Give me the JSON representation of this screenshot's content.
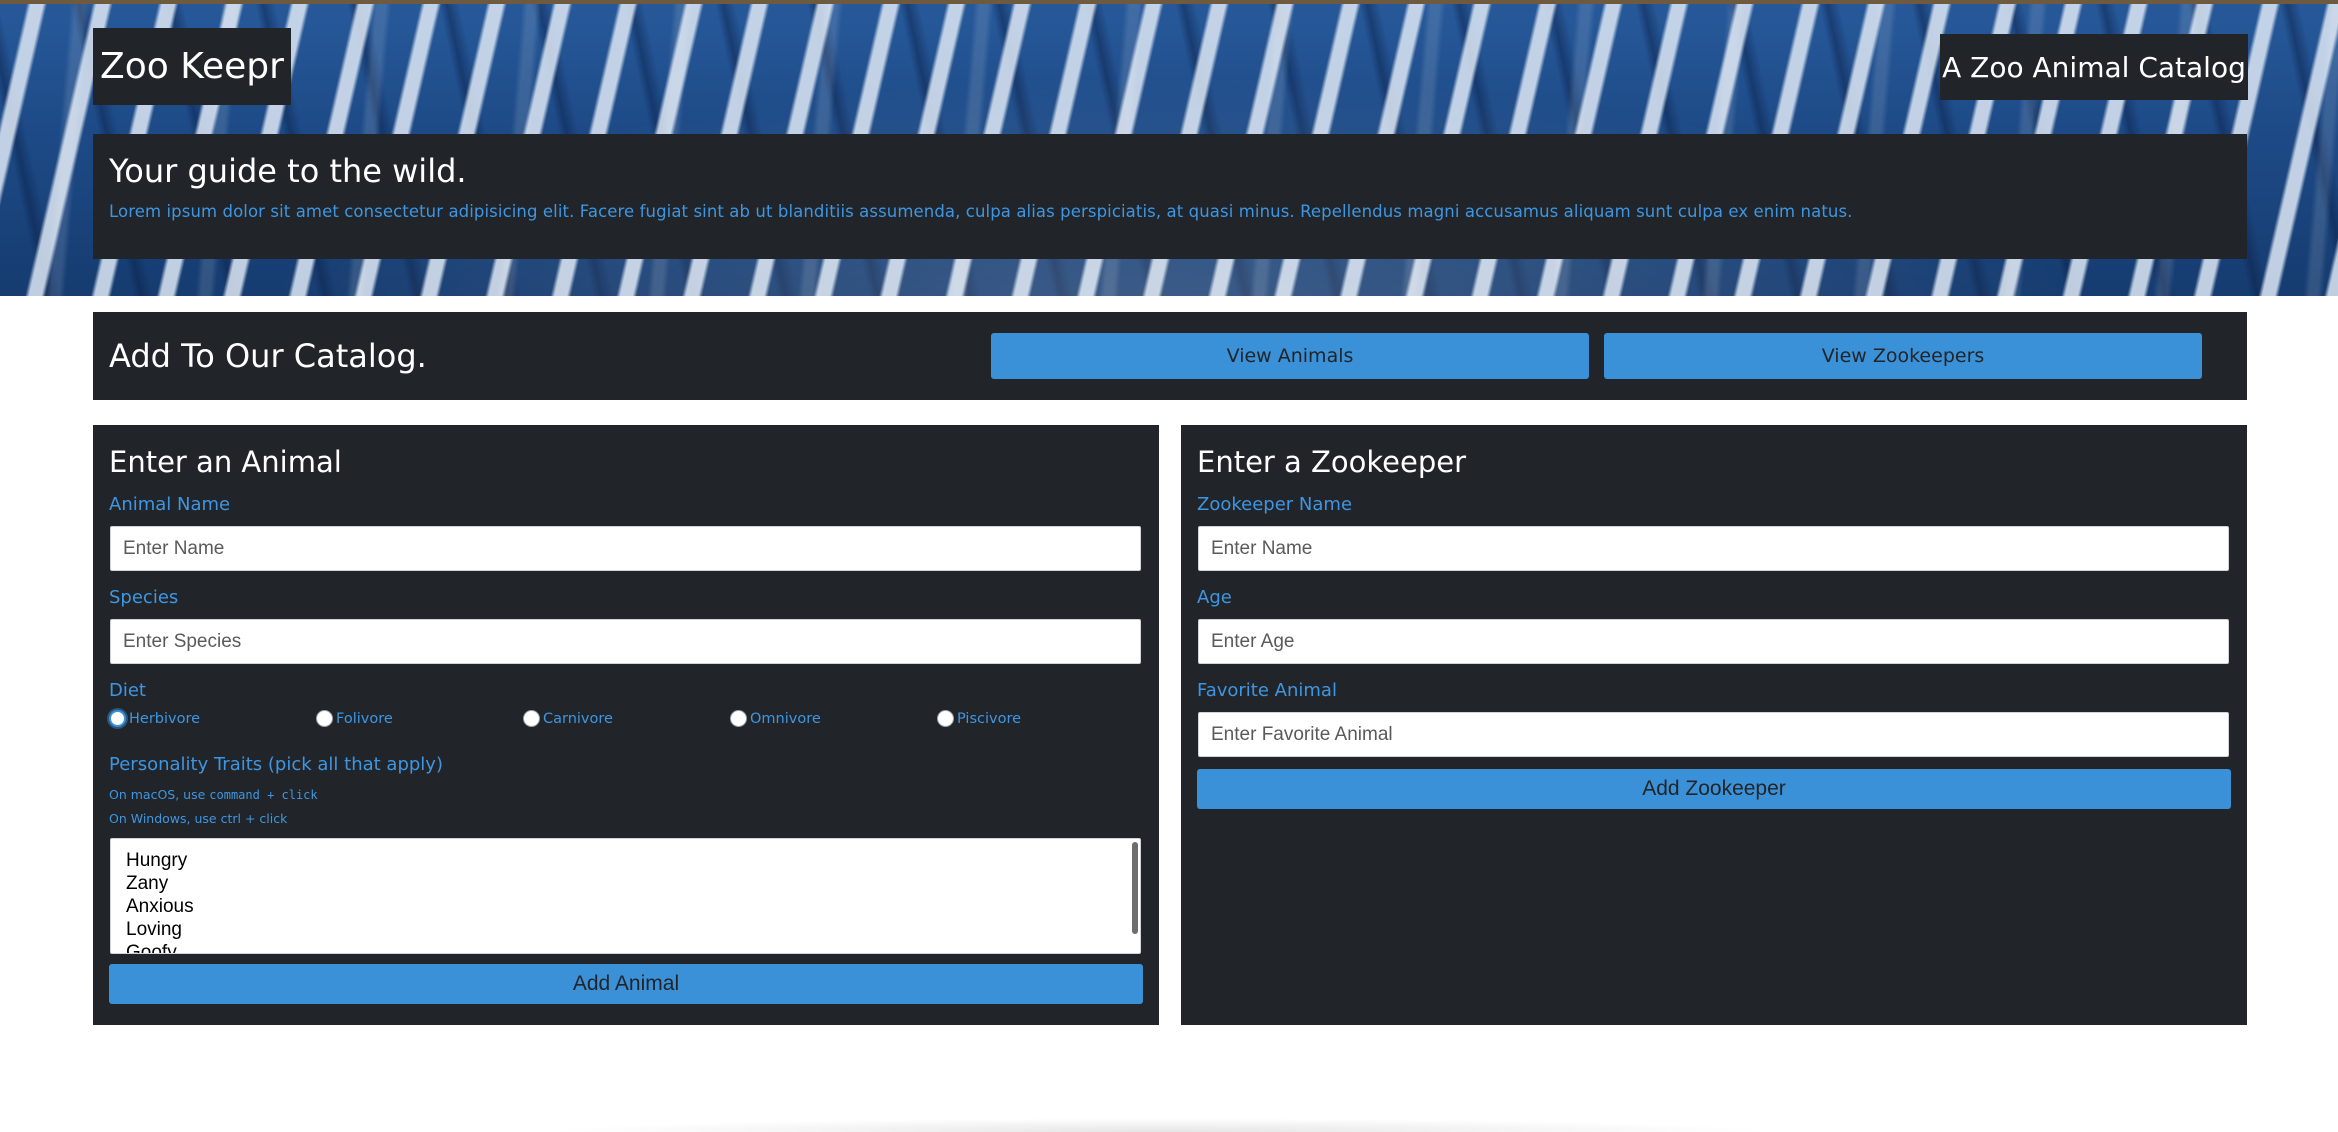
{
  "header": {
    "logo": "Zoo Keepr",
    "tagline": "A Zoo Animal Catalog"
  },
  "jumbotron": {
    "title": "Your guide to the wild.",
    "text": "Lorem ipsum dolor sit amet consectetur adipisicing elit. Facere fugiat sint ab ut blanditiis assumenda, culpa alias perspiciatis, at quasi minus. Repellendus magni accusamus aliquam sunt culpa ex enim natus."
  },
  "catalog": {
    "title": "Add To Our Catalog.",
    "view_animals": "View Animals",
    "view_zookeepers": "View Zookeepers"
  },
  "animal_form": {
    "title": "Enter an Animal",
    "name_label": "Animal Name",
    "name_placeholder": "Enter Name",
    "species_label": "Species",
    "species_placeholder": "Enter Species",
    "diet_label": "Diet",
    "diets": [
      "Herbivore",
      "Folivore",
      "Carnivore",
      "Omnivore",
      "Piscivore"
    ],
    "selected_diet": "Herbivore",
    "traits_label": "Personality Traits (pick all that apply)",
    "hint_mac_prefix": "On macOS, use ",
    "hint_mac_code": "command + click",
    "hint_windows": "On Windows, use ctrl + click",
    "traits": [
      "Hungry",
      "Zany",
      "Anxious",
      "Loving",
      "Goofy"
    ],
    "submit": "Add Animal"
  },
  "zookeeper_form": {
    "title": "Enter a Zookeeper",
    "name_label": "Zookeeper Name",
    "name_placeholder": "Enter Name",
    "age_label": "Age",
    "age_placeholder": "Enter Age",
    "favorite_label": "Favorite Animal",
    "favorite_placeholder": "Enter Favorite Animal",
    "submit": "Add Zookeeper"
  },
  "colors": {
    "panel": "#212529",
    "accent": "#3a91d8",
    "label": "#3e96e2"
  }
}
